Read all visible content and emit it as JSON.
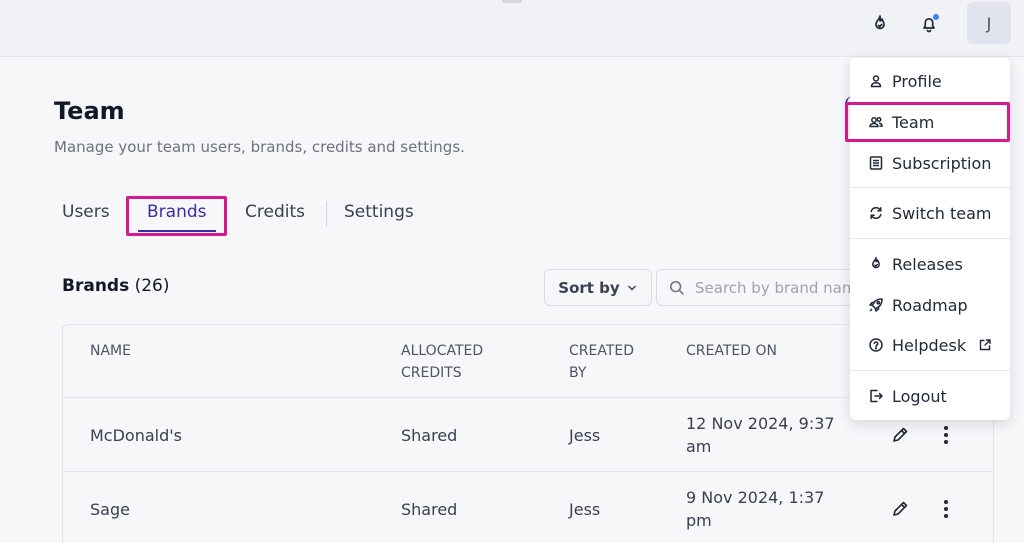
{
  "header": {
    "avatar_initial": "J",
    "releases_icon": "flame-badge-icon",
    "notifications_icon": "bell-icon",
    "notification_dot_color": "#3b82f6"
  },
  "page": {
    "title": "Team",
    "subtitle": "Manage your team users, brands, credits and settings."
  },
  "tabs": [
    {
      "label": "Users"
    },
    {
      "label": "Brands",
      "active": true
    },
    {
      "label": "Credits"
    },
    {
      "label": "Settings"
    }
  ],
  "brands": {
    "heading": "Brands",
    "count": "(26)",
    "sort_label": "Sort by",
    "search_placeholder": "Search by brand name"
  },
  "table": {
    "headers": {
      "name": "NAME",
      "allocated_credits": "ALLOCATED CREDITS",
      "created_by": "CREATED BY",
      "created_on": "CREATED ON"
    },
    "rows": [
      {
        "name": "McDonald's",
        "allocated_credits": "Shared",
        "created_by": "Jess",
        "created_on": "12 Nov 2024, 9:37 am"
      },
      {
        "name": "Sage",
        "allocated_credits": "Shared",
        "created_by": "Jess",
        "created_on": "9 Nov 2024, 1:37 pm"
      }
    ]
  },
  "user_menu": {
    "items": [
      {
        "label": "Profile",
        "icon": "person-icon"
      },
      {
        "label": "Team",
        "icon": "people-icon",
        "highlighted": true
      },
      {
        "label": "Subscription",
        "icon": "list-icon"
      },
      {
        "label": "Switch team",
        "icon": "switch-icon"
      },
      {
        "label": "Releases",
        "icon": "flame-badge-icon"
      },
      {
        "label": "Roadmap",
        "icon": "rocket-icon"
      },
      {
        "label": "Helpdesk",
        "icon": "help-circle-icon",
        "external": true
      },
      {
        "label": "Logout",
        "icon": "logout-icon"
      }
    ]
  },
  "colors": {
    "accent": "#3730a3",
    "highlight_annotation": "#d6198a"
  }
}
